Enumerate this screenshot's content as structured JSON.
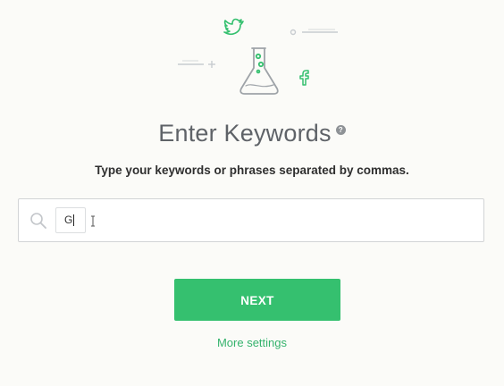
{
  "header": {
    "title": "Enter Keywords",
    "help_icon": "question-mark-icon",
    "subtitle": "Type your keywords or phrases separated by commas."
  },
  "illustration": {
    "icons": [
      "twitter-bird-icon",
      "flask-icon",
      "facebook-icon",
      "decorative-lines"
    ],
    "accent_color": "#35c06f",
    "outline_color": "#9ea3a8"
  },
  "keyword_input": {
    "search_icon": "search-icon",
    "tokens": [
      "G"
    ]
  },
  "actions": {
    "next_label": "NEXT",
    "more_settings_label": "More settings",
    "primary_color": "#35c06f"
  }
}
